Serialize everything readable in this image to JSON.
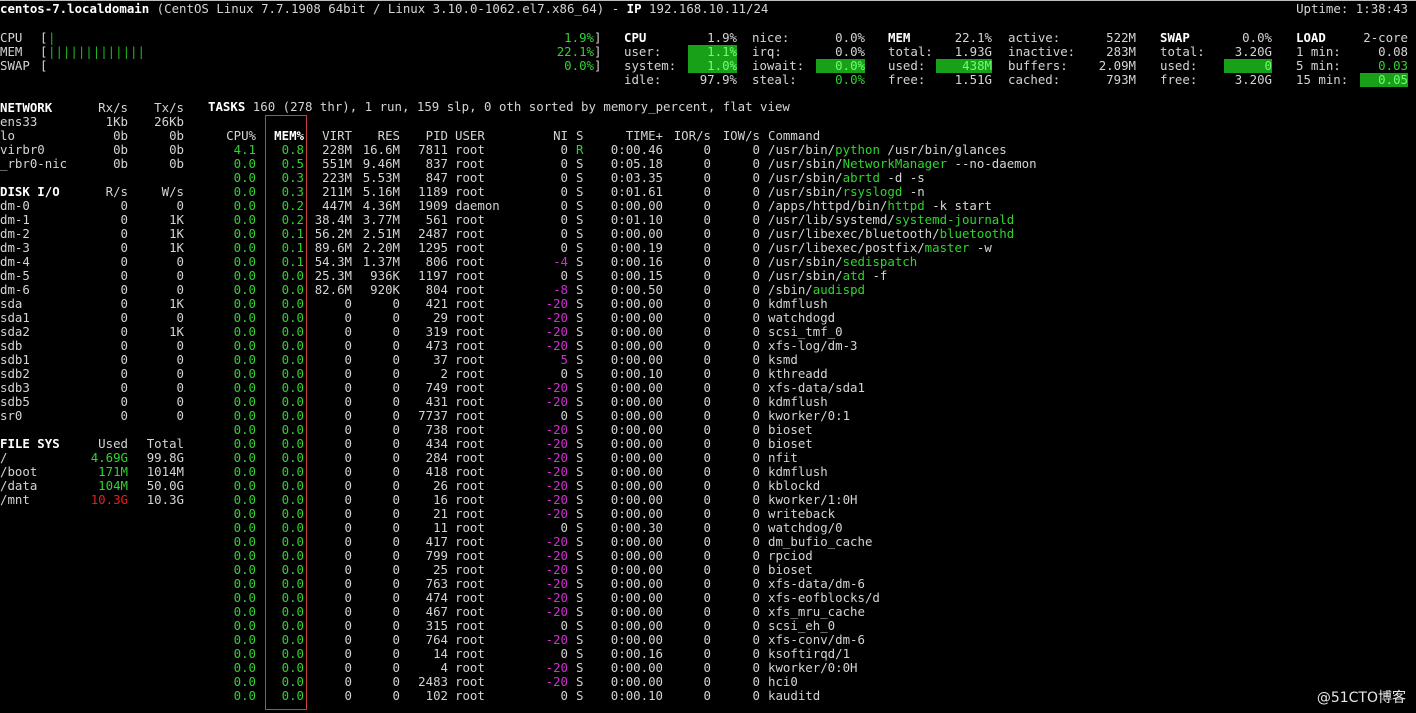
{
  "header": {
    "hostname": "centos-7.localdomain",
    "system": " (CentOS Linux 7.7.1908 64bit / Linux 3.10.0-1062.el7.x86_64) - ",
    "ip_label": "IP",
    "ip": " 192.168.10.11/24",
    "uptime_label": "Uptime:",
    "uptime": "1:38:43"
  },
  "quicklook": [
    {
      "label": "CPU",
      "bar_ticks": 1,
      "percent": 1.9,
      "value": "1.9%"
    },
    {
      "label": "MEM",
      "bar_ticks": 13,
      "percent": 22.1,
      "value": "22.1%"
    },
    {
      "label": "SWAP",
      "bar_ticks": 0,
      "percent": 0.0,
      "value": "0.0%"
    }
  ],
  "cpu": {
    "title": "CPU",
    "total": "1.9%",
    "rows": [
      {
        "label": "user:",
        "value": "1.1%",
        "style": "gbg"
      },
      {
        "label": "system:",
        "value": "1.0%",
        "style": "gbg"
      },
      {
        "label": "idle:",
        "value": "97.9%",
        "style": ""
      }
    ],
    "rows2": [
      {
        "label": "nice:",
        "value": "0.0%",
        "style": ""
      },
      {
        "label": "irq:",
        "value": "0.0%",
        "style": ""
      },
      {
        "label": "iowait:",
        "value": "0.0%",
        "style": "gbg"
      },
      {
        "label": "steal:",
        "value": "0.0%",
        "style": "g"
      }
    ]
  },
  "mem": {
    "title": "MEM",
    "total_pct": "22.1%",
    "rows": [
      {
        "label": "total:",
        "value": "1.93G",
        "style": ""
      },
      {
        "label": "used:",
        "value": "438M",
        "style": "gbg"
      },
      {
        "label": "free:",
        "value": "1.51G",
        "style": ""
      }
    ],
    "rows2": [
      {
        "label": "active:",
        "value": "522M"
      },
      {
        "label": "inactive:",
        "value": "283M"
      },
      {
        "label": "buffers:",
        "value": "2.09M"
      },
      {
        "label": "cached:",
        "value": "793M"
      }
    ]
  },
  "swap": {
    "title": "SWAP",
    "total_pct": "0.0%",
    "rows": [
      {
        "label": "total:",
        "value": "3.20G",
        "style": ""
      },
      {
        "label": "used:",
        "value": "0",
        "style": "gbg"
      },
      {
        "label": "free:",
        "value": "3.20G",
        "style": ""
      }
    ]
  },
  "load": {
    "title": "LOAD",
    "cores": "2-core",
    "rows": [
      {
        "label": "1 min:",
        "value": "0.08",
        "style": ""
      },
      {
        "label": "5 min:",
        "value": "0.03",
        "style": "g"
      },
      {
        "label": "15 min:",
        "value": "0.05",
        "style": "gbg"
      }
    ]
  },
  "network": {
    "title": "NETWORK",
    "rx_label": "Rx/s",
    "tx_label": "Tx/s",
    "rows": [
      {
        "name": "ens33",
        "rx": "1Kb",
        "tx": "26Kb"
      },
      {
        "name": "lo",
        "rx": "0b",
        "tx": "0b"
      },
      {
        "name": "virbr0",
        "rx": "0b",
        "tx": "0b"
      },
      {
        "name": "_rbr0-nic",
        "rx": "0b",
        "tx": "0b"
      }
    ]
  },
  "diskio": {
    "title": "DISK I/O",
    "r_label": "R/s",
    "w_label": "W/s",
    "rows": [
      {
        "name": "dm-0",
        "r": "0",
        "w": "0"
      },
      {
        "name": "dm-1",
        "r": "0",
        "w": "1K"
      },
      {
        "name": "dm-2",
        "r": "0",
        "w": "1K"
      },
      {
        "name": "dm-3",
        "r": "0",
        "w": "1K"
      },
      {
        "name": "dm-4",
        "r": "0",
        "w": "0"
      },
      {
        "name": "dm-5",
        "r": "0",
        "w": "0"
      },
      {
        "name": "dm-6",
        "r": "0",
        "w": "0"
      },
      {
        "name": "sda",
        "r": "0",
        "w": "1K"
      },
      {
        "name": "sda1",
        "r": "0",
        "w": "0"
      },
      {
        "name": "sda2",
        "r": "0",
        "w": "1K"
      },
      {
        "name": "sdb",
        "r": "0",
        "w": "0"
      },
      {
        "name": "sdb1",
        "r": "0",
        "w": "0"
      },
      {
        "name": "sdb2",
        "r": "0",
        "w": "0"
      },
      {
        "name": "sdb3",
        "r": "0",
        "w": "0"
      },
      {
        "name": "sdb5",
        "r": "0",
        "w": "0"
      },
      {
        "name": "sr0",
        "r": "0",
        "w": "0"
      }
    ]
  },
  "fs": {
    "title": "FILE SYS",
    "used_label": "Used",
    "total_label": "Total",
    "rows": [
      {
        "mount": "/",
        "used": "4.69G",
        "total": "99.8G",
        "style": "g"
      },
      {
        "mount": "/boot",
        "used": "171M",
        "total": "1014M",
        "style": "g"
      },
      {
        "mount": "/data",
        "used": "104M",
        "total": "50.0G",
        "style": "g"
      },
      {
        "mount": "/mnt",
        "used": "10.3G",
        "total": "10.3G",
        "style": "r"
      }
    ]
  },
  "tasks": {
    "label": "TASKS",
    "summary": " 160 (278 thr), 1 run, 159 slp, 0 oth sorted by memory_percent, flat view"
  },
  "process_table": {
    "columns": [
      "CPU%",
      "MEM%",
      "VIRT",
      "RES",
      "PID",
      "USER",
      "NI",
      "S",
      "TIME+",
      "IOR/s",
      "IOW/s",
      "Command"
    ],
    "rows": [
      {
        "cpu": "4.1",
        "mem": "0.8",
        "virt": "228M",
        "res": "16.6M",
        "pid": "7811",
        "user": "root",
        "ni": "0",
        "s": "R",
        "time": "0:00.46",
        "ior": "0",
        "iow": "0",
        "cmd_pre": "/usr/bin/",
        "cmd_hl": "python",
        "cmd_post": " /usr/bin/glances"
      },
      {
        "cpu": "0.0",
        "mem": "0.5",
        "virt": "551M",
        "res": "9.46M",
        "pid": "837",
        "user": "root",
        "ni": "0",
        "s": "S",
        "time": "0:05.18",
        "ior": "0",
        "iow": "0",
        "cmd_pre": "/usr/sbin/",
        "cmd_hl": "NetworkManager",
        "cmd_post": " --no-daemon"
      },
      {
        "cpu": "0.0",
        "mem": "0.3",
        "virt": "223M",
        "res": "5.53M",
        "pid": "847",
        "user": "root",
        "ni": "0",
        "s": "S",
        "time": "0:03.35",
        "ior": "0",
        "iow": "0",
        "cmd_pre": "/usr/sbin/",
        "cmd_hl": "abrtd",
        "cmd_post": " -d -s"
      },
      {
        "cpu": "0.0",
        "mem": "0.3",
        "virt": "211M",
        "res": "5.16M",
        "pid": "1189",
        "user": "root",
        "ni": "0",
        "s": "S",
        "time": "0:01.61",
        "ior": "0",
        "iow": "0",
        "cmd_pre": "/usr/sbin/",
        "cmd_hl": "rsyslogd",
        "cmd_post": " -n"
      },
      {
        "cpu": "0.0",
        "mem": "0.2",
        "virt": "447M",
        "res": "4.36M",
        "pid": "1909",
        "user": "daemon",
        "ni": "0",
        "s": "S",
        "time": "0:00.00",
        "ior": "0",
        "iow": "0",
        "cmd_pre": "/apps/httpd/bin/",
        "cmd_hl": "httpd",
        "cmd_post": " -k start"
      },
      {
        "cpu": "0.0",
        "mem": "0.2",
        "virt": "38.4M",
        "res": "3.77M",
        "pid": "561",
        "user": "root",
        "ni": "0",
        "s": "S",
        "time": "0:01.10",
        "ior": "0",
        "iow": "0",
        "cmd_pre": "/usr/lib/systemd/",
        "cmd_hl": "systemd-journald",
        "cmd_post": ""
      },
      {
        "cpu": "0.0",
        "mem": "0.1",
        "virt": "56.2M",
        "res": "2.51M",
        "pid": "2487",
        "user": "root",
        "ni": "0",
        "s": "S",
        "time": "0:00.00",
        "ior": "0",
        "iow": "0",
        "cmd_pre": "/usr/libexec/bluetooth/",
        "cmd_hl": "bluetoothd",
        "cmd_post": ""
      },
      {
        "cpu": "0.0",
        "mem": "0.1",
        "virt": "89.6M",
        "res": "2.20M",
        "pid": "1295",
        "user": "root",
        "ni": "0",
        "s": "S",
        "time": "0:00.19",
        "ior": "0",
        "iow": "0",
        "cmd_pre": "/usr/libexec/postfix/",
        "cmd_hl": "master",
        "cmd_post": " -w"
      },
      {
        "cpu": "0.0",
        "mem": "0.1",
        "virt": "54.3M",
        "res": "1.37M",
        "pid": "806",
        "user": "root",
        "ni": "-4",
        "s": "S",
        "time": "0:00.16",
        "ior": "0",
        "iow": "0",
        "cmd_pre": "/usr/sbin/",
        "cmd_hl": "sedispatch",
        "cmd_post": ""
      },
      {
        "cpu": "0.0",
        "mem": "0.0",
        "virt": "25.3M",
        "res": "936K",
        "pid": "1197",
        "user": "root",
        "ni": "0",
        "s": "S",
        "time": "0:00.15",
        "ior": "0",
        "iow": "0",
        "cmd_pre": "/usr/sbin/",
        "cmd_hl": "atd",
        "cmd_post": " -f"
      },
      {
        "cpu": "0.0",
        "mem": "0.0",
        "virt": "82.6M",
        "res": "920K",
        "pid": "804",
        "user": "root",
        "ni": "-8",
        "s": "S",
        "time": "0:00.50",
        "ior": "0",
        "iow": "0",
        "cmd_pre": "/sbin/",
        "cmd_hl": "audispd",
        "cmd_post": ""
      },
      {
        "cpu": "0.0",
        "mem": "0.0",
        "virt": "0",
        "res": "0",
        "pid": "421",
        "user": "root",
        "ni": "-20",
        "s": "S",
        "time": "0:00.00",
        "ior": "0",
        "iow": "0",
        "cmd_pre": "kdmflush",
        "cmd_hl": "",
        "cmd_post": ""
      },
      {
        "cpu": "0.0",
        "mem": "0.0",
        "virt": "0",
        "res": "0",
        "pid": "29",
        "user": "root",
        "ni": "-20",
        "s": "S",
        "time": "0:00.00",
        "ior": "0",
        "iow": "0",
        "cmd_pre": "watchdogd",
        "cmd_hl": "",
        "cmd_post": ""
      },
      {
        "cpu": "0.0",
        "mem": "0.0",
        "virt": "0",
        "res": "0",
        "pid": "319",
        "user": "root",
        "ni": "-20",
        "s": "S",
        "time": "0:00.00",
        "ior": "0",
        "iow": "0",
        "cmd_pre": "scsi_tmf_0",
        "cmd_hl": "",
        "cmd_post": ""
      },
      {
        "cpu": "0.0",
        "mem": "0.0",
        "virt": "0",
        "res": "0",
        "pid": "473",
        "user": "root",
        "ni": "-20",
        "s": "S",
        "time": "0:00.00",
        "ior": "0",
        "iow": "0",
        "cmd_pre": "xfs-log/dm-3",
        "cmd_hl": "",
        "cmd_post": ""
      },
      {
        "cpu": "0.0",
        "mem": "0.0",
        "virt": "0",
        "res": "0",
        "pid": "37",
        "user": "root",
        "ni": "5",
        "s": "S",
        "time": "0:00.00",
        "ior": "0",
        "iow": "0",
        "cmd_pre": "ksmd",
        "cmd_hl": "",
        "cmd_post": ""
      },
      {
        "cpu": "0.0",
        "mem": "0.0",
        "virt": "0",
        "res": "0",
        "pid": "2",
        "user": "root",
        "ni": "0",
        "s": "S",
        "time": "0:00.10",
        "ior": "0",
        "iow": "0",
        "cmd_pre": "kthreadd",
        "cmd_hl": "",
        "cmd_post": ""
      },
      {
        "cpu": "0.0",
        "mem": "0.0",
        "virt": "0",
        "res": "0",
        "pid": "749",
        "user": "root",
        "ni": "-20",
        "s": "S",
        "time": "0:00.00",
        "ior": "0",
        "iow": "0",
        "cmd_pre": "xfs-data/sda1",
        "cmd_hl": "",
        "cmd_post": ""
      },
      {
        "cpu": "0.0",
        "mem": "0.0",
        "virt": "0",
        "res": "0",
        "pid": "431",
        "user": "root",
        "ni": "-20",
        "s": "S",
        "time": "0:00.00",
        "ior": "0",
        "iow": "0",
        "cmd_pre": "kdmflush",
        "cmd_hl": "",
        "cmd_post": ""
      },
      {
        "cpu": "0.0",
        "mem": "0.0",
        "virt": "0",
        "res": "0",
        "pid": "7737",
        "user": "root",
        "ni": "0",
        "s": "S",
        "time": "0:00.00",
        "ior": "0",
        "iow": "0",
        "cmd_pre": "kworker/0:1",
        "cmd_hl": "",
        "cmd_post": ""
      },
      {
        "cpu": "0.0",
        "mem": "0.0",
        "virt": "0",
        "res": "0",
        "pid": "738",
        "user": "root",
        "ni": "-20",
        "s": "S",
        "time": "0:00.00",
        "ior": "0",
        "iow": "0",
        "cmd_pre": "bioset",
        "cmd_hl": "",
        "cmd_post": ""
      },
      {
        "cpu": "0.0",
        "mem": "0.0",
        "virt": "0",
        "res": "0",
        "pid": "434",
        "user": "root",
        "ni": "-20",
        "s": "S",
        "time": "0:00.00",
        "ior": "0",
        "iow": "0",
        "cmd_pre": "bioset",
        "cmd_hl": "",
        "cmd_post": ""
      },
      {
        "cpu": "0.0",
        "mem": "0.0",
        "virt": "0",
        "res": "0",
        "pid": "284",
        "user": "root",
        "ni": "-20",
        "s": "S",
        "time": "0:00.00",
        "ior": "0",
        "iow": "0",
        "cmd_pre": "nfit",
        "cmd_hl": "",
        "cmd_post": ""
      },
      {
        "cpu": "0.0",
        "mem": "0.0",
        "virt": "0",
        "res": "0",
        "pid": "418",
        "user": "root",
        "ni": "-20",
        "s": "S",
        "time": "0:00.00",
        "ior": "0",
        "iow": "0",
        "cmd_pre": "kdmflush",
        "cmd_hl": "",
        "cmd_post": ""
      },
      {
        "cpu": "0.0",
        "mem": "0.0",
        "virt": "0",
        "res": "0",
        "pid": "26",
        "user": "root",
        "ni": "-20",
        "s": "S",
        "time": "0:00.00",
        "ior": "0",
        "iow": "0",
        "cmd_pre": "kblockd",
        "cmd_hl": "",
        "cmd_post": ""
      },
      {
        "cpu": "0.0",
        "mem": "0.0",
        "virt": "0",
        "res": "0",
        "pid": "16",
        "user": "root",
        "ni": "-20",
        "s": "S",
        "time": "0:00.00",
        "ior": "0",
        "iow": "0",
        "cmd_pre": "kworker/1:0H",
        "cmd_hl": "",
        "cmd_post": ""
      },
      {
        "cpu": "0.0",
        "mem": "0.0",
        "virt": "0",
        "res": "0",
        "pid": "21",
        "user": "root",
        "ni": "-20",
        "s": "S",
        "time": "0:00.00",
        "ior": "0",
        "iow": "0",
        "cmd_pre": "writeback",
        "cmd_hl": "",
        "cmd_post": ""
      },
      {
        "cpu": "0.0",
        "mem": "0.0",
        "virt": "0",
        "res": "0",
        "pid": "11",
        "user": "root",
        "ni": "0",
        "s": "S",
        "time": "0:00.30",
        "ior": "0",
        "iow": "0",
        "cmd_pre": "watchdog/0",
        "cmd_hl": "",
        "cmd_post": ""
      },
      {
        "cpu": "0.0",
        "mem": "0.0",
        "virt": "0",
        "res": "0",
        "pid": "417",
        "user": "root",
        "ni": "-20",
        "s": "S",
        "time": "0:00.00",
        "ior": "0",
        "iow": "0",
        "cmd_pre": "dm_bufio_cache",
        "cmd_hl": "",
        "cmd_post": ""
      },
      {
        "cpu": "0.0",
        "mem": "0.0",
        "virt": "0",
        "res": "0",
        "pid": "799",
        "user": "root",
        "ni": "-20",
        "s": "S",
        "time": "0:00.00",
        "ior": "0",
        "iow": "0",
        "cmd_pre": "rpciod",
        "cmd_hl": "",
        "cmd_post": ""
      },
      {
        "cpu": "0.0",
        "mem": "0.0",
        "virt": "0",
        "res": "0",
        "pid": "25",
        "user": "root",
        "ni": "-20",
        "s": "S",
        "time": "0:00.00",
        "ior": "0",
        "iow": "0",
        "cmd_pre": "bioset",
        "cmd_hl": "",
        "cmd_post": ""
      },
      {
        "cpu": "0.0",
        "mem": "0.0",
        "virt": "0",
        "res": "0",
        "pid": "763",
        "user": "root",
        "ni": "-20",
        "s": "S",
        "time": "0:00.00",
        "ior": "0",
        "iow": "0",
        "cmd_pre": "xfs-data/dm-6",
        "cmd_hl": "",
        "cmd_post": ""
      },
      {
        "cpu": "0.0",
        "mem": "0.0",
        "virt": "0",
        "res": "0",
        "pid": "474",
        "user": "root",
        "ni": "-20",
        "s": "S",
        "time": "0:00.00",
        "ior": "0",
        "iow": "0",
        "cmd_pre": "xfs-eofblocks/d",
        "cmd_hl": "",
        "cmd_post": ""
      },
      {
        "cpu": "0.0",
        "mem": "0.0",
        "virt": "0",
        "res": "0",
        "pid": "467",
        "user": "root",
        "ni": "-20",
        "s": "S",
        "time": "0:00.00",
        "ior": "0",
        "iow": "0",
        "cmd_pre": "xfs_mru_cache",
        "cmd_hl": "",
        "cmd_post": ""
      },
      {
        "cpu": "0.0",
        "mem": "0.0",
        "virt": "0",
        "res": "0",
        "pid": "315",
        "user": "root",
        "ni": "0",
        "s": "S",
        "time": "0:00.00",
        "ior": "0",
        "iow": "0",
        "cmd_pre": "scsi_eh_0",
        "cmd_hl": "",
        "cmd_post": ""
      },
      {
        "cpu": "0.0",
        "mem": "0.0",
        "virt": "0",
        "res": "0",
        "pid": "764",
        "user": "root",
        "ni": "-20",
        "s": "S",
        "time": "0:00.00",
        "ior": "0",
        "iow": "0",
        "cmd_pre": "xfs-conv/dm-6",
        "cmd_hl": "",
        "cmd_post": ""
      },
      {
        "cpu": "0.0",
        "mem": "0.0",
        "virt": "0",
        "res": "0",
        "pid": "14",
        "user": "root",
        "ni": "0",
        "s": "S",
        "time": "0:00.16",
        "ior": "0",
        "iow": "0",
        "cmd_pre": "ksoftirqd/1",
        "cmd_hl": "",
        "cmd_post": ""
      },
      {
        "cpu": "0.0",
        "mem": "0.0",
        "virt": "0",
        "res": "0",
        "pid": "4",
        "user": "root",
        "ni": "-20",
        "s": "S",
        "time": "0:00.00",
        "ior": "0",
        "iow": "0",
        "cmd_pre": "kworker/0:0H",
        "cmd_hl": "",
        "cmd_post": ""
      },
      {
        "cpu": "0.0",
        "mem": "0.0",
        "virt": "0",
        "res": "0",
        "pid": "2483",
        "user": "root",
        "ni": "-20",
        "s": "S",
        "time": "0:00.00",
        "ior": "0",
        "iow": "0",
        "cmd_pre": "hci0",
        "cmd_hl": "",
        "cmd_post": ""
      },
      {
        "cpu": "0.0",
        "mem": "0.0",
        "virt": "0",
        "res": "0",
        "pid": "102",
        "user": "root",
        "ni": "0",
        "s": "S",
        "time": "0:00.10",
        "ior": "0",
        "iow": "0",
        "cmd_pre": "kauditd",
        "cmd_hl": "",
        "cmd_post": ""
      }
    ]
  },
  "colors": {
    "background": "#000000",
    "text": "#d4d4d4",
    "ok_green": "#2ed52e",
    "ok_bg_green": "#18a018",
    "critical_red": "#e0221f",
    "nice_magenta": "#d030d0",
    "highlight_box": "#c94040"
  },
  "watermark": "@51CTO博客"
}
